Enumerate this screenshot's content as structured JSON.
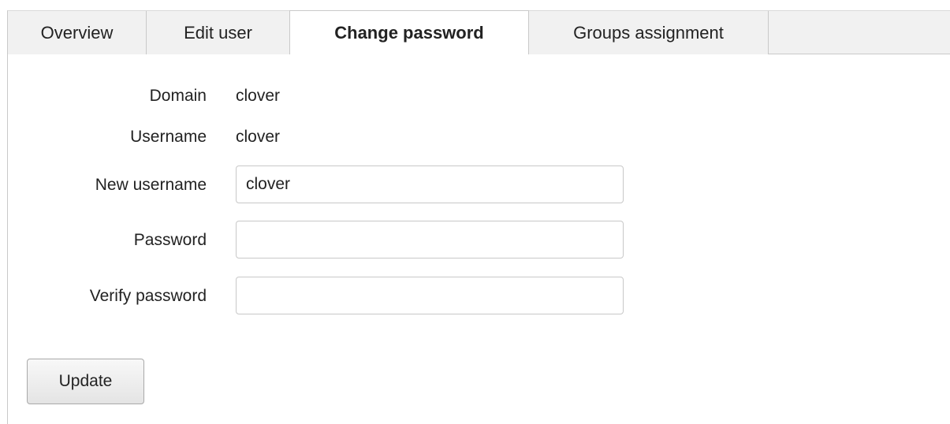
{
  "tabs": [
    {
      "label": "Overview",
      "active": false
    },
    {
      "label": "Edit user",
      "active": false
    },
    {
      "label": "Change password",
      "active": true
    },
    {
      "label": "Groups assignment",
      "active": false
    }
  ],
  "form": {
    "domain": {
      "label": "Domain",
      "value": "clover"
    },
    "username": {
      "label": "Username",
      "value": "clover"
    },
    "new_username": {
      "label": "New username",
      "value": "clover",
      "placeholder": ""
    },
    "password": {
      "label": "Password",
      "value": ""
    },
    "verify_password": {
      "label": "Verify password",
      "value": ""
    }
  },
  "actions": {
    "update_label": "Update"
  }
}
